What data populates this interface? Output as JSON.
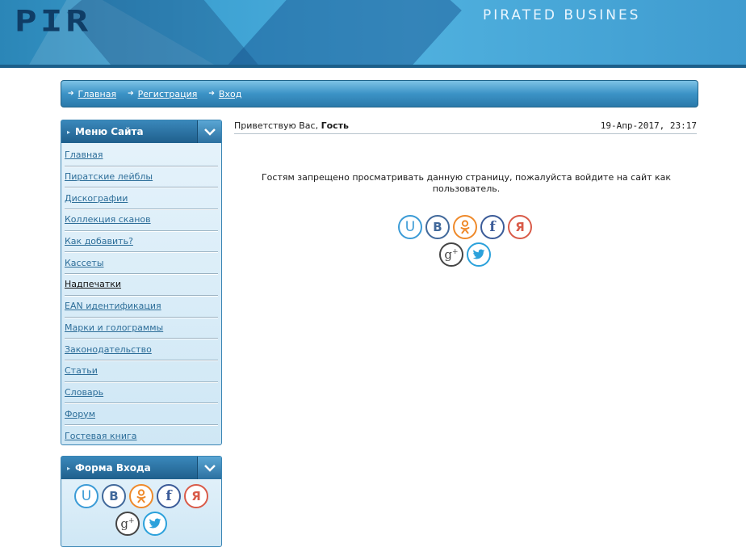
{
  "header": {
    "logo_text": "PIR",
    "tagline": "PIRATED BUSINES"
  },
  "navbar": {
    "items": [
      {
        "label": "Главная"
      },
      {
        "label": "Регистрация"
      },
      {
        "label": "Вход"
      }
    ]
  },
  "sidebar": {
    "menu": {
      "title": "Меню Сайта",
      "items": [
        {
          "label": "Главная"
        },
        {
          "label": "Пиратские лейблы"
        },
        {
          "label": "Дискографии"
        },
        {
          "label": "Коллекция сканов"
        },
        {
          "label": "Как добавить?"
        },
        {
          "label": "Кассеты"
        },
        {
          "label": "Надпечатки"
        },
        {
          "label": "EAN идентификация"
        },
        {
          "label": "Марки и голограммы"
        },
        {
          "label": "Законодательство"
        },
        {
          "label": "Статьи"
        },
        {
          "label": "Словарь"
        },
        {
          "label": "Форум"
        },
        {
          "label": "Гостевая книга"
        }
      ]
    },
    "login": {
      "title": "Форма Входа"
    }
  },
  "main": {
    "greeting_prefix": "Приветствую Вас, ",
    "greeting_user": "Гость",
    "datetime": "19-Апр-2017, 23:17",
    "notice": "Гостям запрещено просматривать данную страницу, пожалуйста войдите на сайт как пользователь."
  },
  "social": [
    {
      "name": "ucoz-icon",
      "glyph": "U",
      "color": "#3b9bd6"
    },
    {
      "name": "vk-icon",
      "glyph": "B",
      "color": "#41699b"
    },
    {
      "name": "odnoklassniki-icon",
      "glyph": "ok",
      "color": "#ef8a2b"
    },
    {
      "name": "facebook-icon",
      "glyph": "f",
      "color": "#3b5b98"
    },
    {
      "name": "yandex-icon",
      "glyph": "Я",
      "color": "#d95b49"
    },
    {
      "name": "google-plus-icon",
      "glyph": "g+",
      "color": "#454545"
    },
    {
      "name": "twitter-icon",
      "glyph": "tw",
      "color": "#2ba1db"
    }
  ]
}
